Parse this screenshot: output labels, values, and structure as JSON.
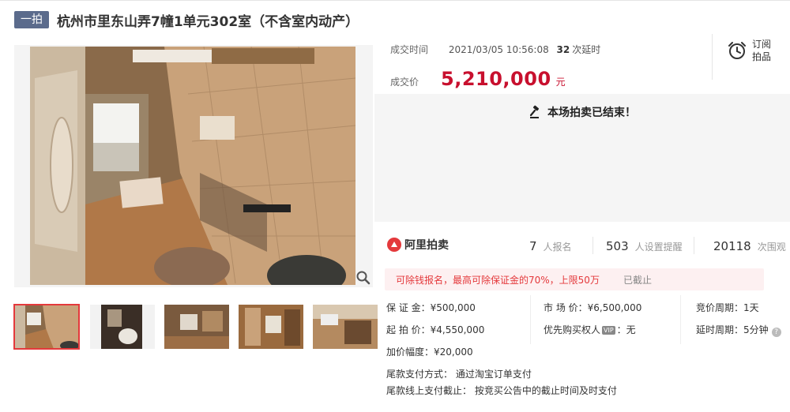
{
  "header": {
    "badge": "一拍",
    "title": "杭州市里东山弄7幢1单元302室（不含室内动产）"
  },
  "deal": {
    "time_label": "成交时间",
    "time_value": "2021/03/05 10:56:08",
    "extensions_count": "32",
    "extensions_unit": "次延时",
    "price_label": "成交价",
    "price_value": "5,210,000",
    "price_unit": "元"
  },
  "subscribe": {
    "label_line1": "订阅",
    "label_line2": "拍品"
  },
  "status": {
    "ended_message": "本场拍卖已结束！"
  },
  "stats": {
    "brand": "阿里拍卖",
    "signups": "7",
    "signups_label": "人报名",
    "reminders": "503",
    "reminders_label": "人设置提醒",
    "views": "20118",
    "views_label": "次围观"
  },
  "deposit_tip": {
    "message": "可除钱报名，最高可除保证金的70%，上限50万",
    "status": "已截止"
  },
  "details": {
    "deposit": "保 证 金：¥500,000",
    "start_price": "起 拍 价：¥4,550,000",
    "increment": "加价幅度：¥20,000",
    "market_price": "市 场 价：¥6,500,000",
    "priority_prefix": "优先购买权人",
    "priority_badge": "VIP",
    "priority_value": "：无",
    "bid_period": "竞价周期：1天",
    "delay_period": "延时周期：5分钟",
    "payment_method": "尾款支付方式： 通过淘宝订单支付",
    "payment_deadline": "尾款线上支付截止： 按竞买公告中的截止时间及时支付"
  },
  "colors": {
    "badge_bg": "#5b6b8c",
    "price_red": "#c8102e",
    "accent_red": "#e4393c",
    "ended_bg": "#f5f5f5"
  }
}
